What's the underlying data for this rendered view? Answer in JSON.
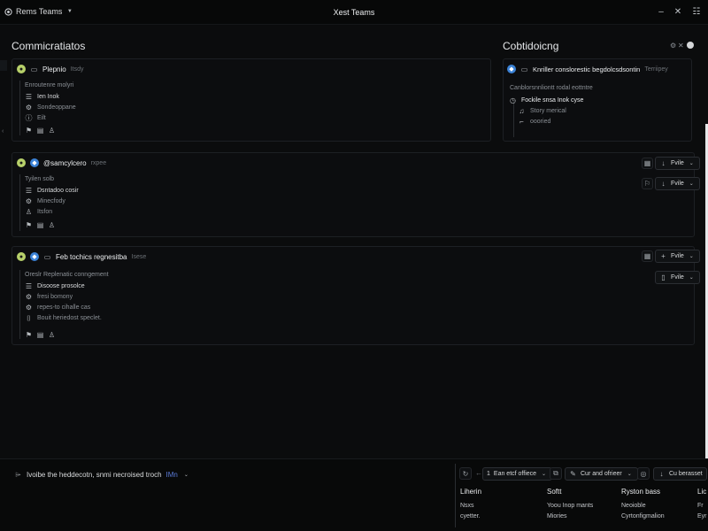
{
  "titlebar": {
    "app_name": "Rems Teams",
    "window_title": "Xest Teams"
  },
  "communications": {
    "title": "Commicratiatos",
    "card1": {
      "name": "Plepnio",
      "meta": "Itsdy",
      "sub": "Enroutenre molyri",
      "items": [
        "Ien Inok",
        "Sondeoppane",
        "Eilt"
      ]
    },
    "card2": {
      "name": "@samcylcero",
      "meta": "rxpee",
      "sub": "Tyilen solb",
      "items": [
        "Dsntadoo cosir",
        "Minecfody",
        "Itsfon"
      ],
      "buttons": [
        "Fvile",
        "Fvile"
      ]
    },
    "card3": {
      "name": "Feb tochics regnesitba",
      "meta": "Isese",
      "sub": "Oreslr Replenatic conngement",
      "items": [
        "Disoose prosolce",
        "fresi bomony",
        "repes-to cihalle cas",
        "Bouit heriedost speclet."
      ],
      "buttons": [
        "Fvile",
        "Fvile"
      ]
    }
  },
  "collaboration": {
    "title": "Cobtidoicng",
    "card": {
      "name": "Knriller conslorestic begdolcsdsontin",
      "meta": "Terriipey",
      "sub": "Canblorsnnliontt rodal eottntre",
      "item_main": "Fockile snsa Inok cyse",
      "items": [
        "Story merical",
        "oooried"
      ]
    }
  },
  "bottom": {
    "composer": "Ivoibe the heddecotn, snmi necroised troch",
    "composer_tag": "IMn",
    "dropdowns": [
      "Ean etcf offiece",
      "Cur and ofrieer",
      "Cu berasset"
    ],
    "columns": [
      {
        "title": "Liherin",
        "links": [
          "Nsxs",
          "cyetter."
        ]
      },
      {
        "title": "Softt",
        "links": [
          "Yoou Inop mants",
          "Miories"
        ]
      },
      {
        "title": "Ryston bass",
        "links": [
          "Neoioble",
          "Cyrtonfigmalion"
        ]
      },
      {
        "title": "Lic",
        "links": [
          "Fr",
          "Eyr"
        ]
      }
    ]
  },
  "colors": {
    "background": "#0b0c0d",
    "card_border": "#1d2024",
    "accent_green": "#b7d06a",
    "accent_blue": "#3b82d6"
  }
}
